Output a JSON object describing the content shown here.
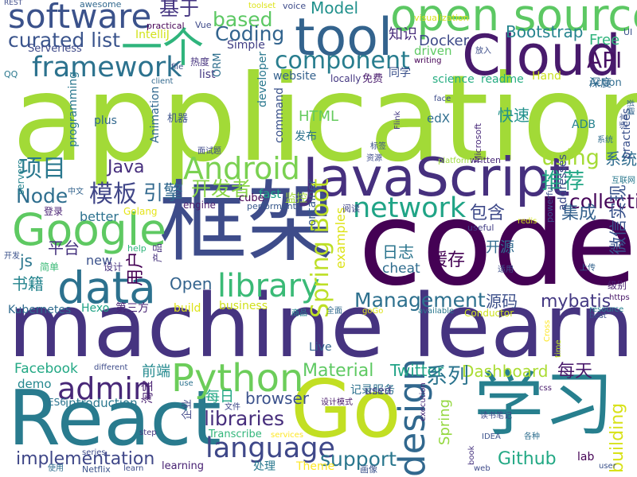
{
  "words": [
    {
      "text": "application",
      "color": "#a2da37"
    },
    {
      "text": "machine learning",
      "color": "#463480"
    },
    {
      "text": "code",
      "color": "#440154"
    },
    {
      "text": "框架",
      "color": "#3e4c8a"
    },
    {
      "text": "React",
      "color": "#297b8e"
    },
    {
      "text": "JavaScript",
      "color": "#46307e"
    },
    {
      "text": "学习",
      "color": "#277f8e"
    },
    {
      "text": "Go",
      "color": "#c2df23"
    },
    {
      "text": "open source",
      "color": "#5cc863"
    },
    {
      "text": "tool",
      "color": "#33638d"
    },
    {
      "text": "Cloud",
      "color": "#481a6c"
    },
    {
      "text": "Google",
      "color": "#5ec962"
    },
    {
      "text": "data",
      "color": "#2c718e"
    },
    {
      "text": "software",
      "color": "#3b528b"
    },
    {
      "text": "一个",
      "color": "#2fb47c"
    },
    {
      "text": "framework",
      "color": "#2c728e"
    },
    {
      "text": "component",
      "color": "#287d8e"
    },
    {
      "text": "Android",
      "color": "#7ad151"
    },
    {
      "text": "Python",
      "color": "#6ccd5a"
    },
    {
      "text": "library",
      "color": "#3aba76"
    },
    {
      "text": "network",
      "color": "#20a486"
    },
    {
      "text": "language",
      "color": "#3f4889"
    },
    {
      "text": "design",
      "color": "#31688e"
    },
    {
      "text": "admin",
      "color": "#482878"
    },
    {
      "text": "Spring Boot",
      "color": "#bddf26"
    },
    {
      "text": "模板",
      "color": "#404688"
    },
    {
      "text": "项目",
      "color": "#2a788e"
    },
    {
      "text": "API",
      "color": "#471164"
    },
    {
      "text": "curated list",
      "color": "#3a548c"
    },
    {
      "text": "based",
      "color": "#5cc863"
    },
    {
      "text": "Coding",
      "color": "#32648e"
    },
    {
      "text": "基于",
      "color": "#453581"
    },
    {
      "text": "Model",
      "color": "#21918c"
    },
    {
      "text": "Bootstrap",
      "color": "#25848e"
    },
    {
      "text": "Free",
      "color": "#2fb47c"
    },
    {
      "text": "知识",
      "color": "#472d7b"
    },
    {
      "text": "Docker",
      "color": "#3e4a89"
    },
    {
      "text": "driven",
      "color": "#5ec962"
    },
    {
      "text": "using",
      "color": "#a5db36"
    },
    {
      "text": "推荐",
      "color": "#21a685"
    },
    {
      "text": "collection",
      "color": "#450559"
    },
    {
      "text": "系统",
      "color": "#2f6c8e"
    },
    {
      "text": "引擎",
      "color": "#31688e"
    },
    {
      "text": "开发者",
      "color": "#89d548"
    },
    {
      "text": "Java",
      "color": "#472f7d"
    },
    {
      "text": "Node",
      "color": "#2e6e8e"
    },
    {
      "text": "包含",
      "color": "#3e4989"
    },
    {
      "text": "集成",
      "color": "#34618d"
    },
    {
      "text": "微信实现",
      "color": "#3a548c"
    },
    {
      "text": "Management",
      "color": "#2d708e"
    },
    {
      "text": "mybatis",
      "color": "#443983"
    },
    {
      "text": "Open",
      "color": "#33638d"
    },
    {
      "text": "Material",
      "color": "#5ec962"
    },
    {
      "text": "Twitter",
      "color": "#20a386"
    },
    {
      "text": "Dashboard",
      "color": "#aadc32"
    },
    {
      "text": "每天",
      "color": "#48186a"
    },
    {
      "text": "implementation",
      "color": "#3f4788"
    },
    {
      "text": "libraries",
      "color": "#472e7c"
    },
    {
      "text": "support",
      "color": "#2a778e"
    },
    {
      "text": "Github",
      "color": "#22a884"
    },
    {
      "text": "building",
      "color": "#d8e219"
    },
    {
      "text": "系列",
      "color": "#2b748e"
    },
    {
      "text": "Spring",
      "color": "#95d840"
    },
    {
      "text": "browser",
      "color": "#3b518b"
    },
    {
      "text": "Facebook",
      "color": "#22a884"
    },
    {
      "text": "cheat",
      "color": "#2f6c8e"
    },
    {
      "text": "日志",
      "color": "#2b758e"
    },
    {
      "text": "缓存",
      "color": "#440154"
    },
    {
      "text": "源码",
      "color": "#3c4f8a"
    },
    {
      "text": "Kubernetes",
      "color": "#2f6b8e"
    },
    {
      "text": "Hexo",
      "color": "#20a386"
    },
    {
      "text": "第三方",
      "color": "#482475"
    },
    {
      "text": "business",
      "color": "#d0e11c"
    },
    {
      "text": "Live",
      "color": "#32648e"
    },
    {
      "text": "前端",
      "color": "#23898e"
    },
    {
      "text": "每日",
      "color": "#22a785"
    },
    {
      "text": "examples",
      "color": "#dde318"
    },
    {
      "text": "Theme",
      "color": "#fde725"
    },
    {
      "text": "learning",
      "color": "#482173"
    },
    {
      "text": "Transcribe",
      "color": "#32b67a"
    },
    {
      "text": "lab",
      "color": "#440154"
    },
    {
      "text": "用户",
      "color": "#440154"
    },
    {
      "text": "书籍",
      "color": "#25848e"
    },
    {
      "text": "平台",
      "color": "#46337f"
    },
    {
      "text": "js",
      "color": "#2a768e"
    },
    {
      "text": "fast",
      "color": "#20a386"
    },
    {
      "text": "HTML",
      "color": "#65cb5e"
    },
    {
      "text": "edX",
      "color": "#2e6e8e"
    },
    {
      "text": "快速",
      "color": "#21918c"
    },
    {
      "text": "开源",
      "color": "#306a8e"
    },
    {
      "text": "监控",
      "color": "#a2da37"
    },
    {
      "text": "记录服务",
      "color": "#2d718e"
    },
    {
      "text": "new",
      "color": "#3b528b"
    },
    {
      "text": "demo",
      "color": "#24878e"
    },
    {
      "text": "introduction",
      "color": "#2a788e"
    },
    {
      "text": "used",
      "color": "#433e85"
    },
    {
      "text": "Serverless",
      "color": "#3e4989"
    },
    {
      "text": "Simple",
      "color": "#423f85"
    },
    {
      "text": "IntelliJ",
      "color": "#d2e21b"
    },
    {
      "text": "website",
      "color": "#34618d"
    },
    {
      "text": "同学",
      "color": "#3b518b"
    },
    {
      "text": "science",
      "color": "#26ad81"
    },
    {
      "text": "readme",
      "color": "#25ac82"
    },
    {
      "text": "Hand",
      "color": "#cae11f"
    },
    {
      "text": "深度",
      "color": "#31688e"
    },
    {
      "text": "practices",
      "color": "#3b518b"
    },
    {
      "text": "ADB",
      "color": "#26828e"
    },
    {
      "text": "addresses",
      "color": "#3e4a89"
    },
    {
      "text": "Microsoft",
      "color": "#482979"
    },
    {
      "text": "command",
      "color": "#3b528b"
    },
    {
      "text": "developer",
      "color": "#2a788e"
    },
    {
      "text": "Animation",
      "color": "#31688e"
    },
    {
      "text": "programming",
      "color": "#2a778e"
    },
    {
      "text": "机器",
      "color": "#3b528b"
    },
    {
      "text": "plus",
      "color": "#31688e"
    },
    {
      "text": "list",
      "color": "#453882"
    },
    {
      "text": "ORM",
      "color": "#2e6f8e"
    },
    {
      "text": "发布",
      "color": "#2c728e"
    },
    {
      "text": "cube",
      "color": "#440154"
    },
    {
      "text": "better",
      "color": "#2c718e"
    },
    {
      "text": "Golang",
      "color": "#e5e419"
    },
    {
      "text": "engine",
      "color": "#48186a"
    },
    {
      "text": "performant",
      "color": "#38588c"
    },
    {
      "text": "container",
      "color": "#38598c"
    },
    {
      "text": "useful",
      "color": "#433e85"
    },
    {
      "text": "阅读",
      "color": "#404688"
    },
    {
      "text": "redis",
      "color": "#d2e21b"
    },
    {
      "text": "powerful",
      "color": "#3e4c8a"
    },
    {
      "text": "登录",
      "color": "#482173"
    },
    {
      "text": "help",
      "color": "#2fb47c"
    },
    {
      "text": "简单",
      "color": "#3aba76"
    },
    {
      "text": "设计",
      "color": "#46307e"
    },
    {
      "text": "产品",
      "color": "#46327e"
    },
    {
      "text": "适用",
      "color": "#3d4e8a"
    },
    {
      "text": "上传",
      "color": "#33638d"
    },
    {
      "text": "级别",
      "color": "#481f70"
    },
    {
      "text": "https",
      "color": "#481769"
    },
    {
      "text": "resource",
      "color": "#26818e"
    },
    {
      "text": "best",
      "color": "#3b528b"
    },
    {
      "text": "Conductor",
      "color": "#cde11d"
    },
    {
      "text": "available",
      "color": "#2a788e"
    },
    {
      "text": "goGo",
      "color": "#dde318"
    },
    {
      "text": "全面",
      "color": "#306a8e"
    },
    {
      "text": "商品",
      "color": "#25858e"
    },
    {
      "text": "build",
      "color": "#dde318"
    },
    {
      "text": "Cross",
      "color": "#fde725"
    },
    {
      "text": "time",
      "color": "#bddf26"
    },
    {
      "text": "different",
      "color": "#3e4c8a"
    },
    {
      "text": "use",
      "color": "#2c738e"
    },
    {
      "text": "淘宝",
      "color": "#482071"
    },
    {
      "text": "文件",
      "color": "#3e4a89"
    },
    {
      "text": "企业",
      "color": "#3f4788"
    },
    {
      "text": "设计模式",
      "color": "#48196b"
    },
    {
      "text": "execution",
      "color": "#482979"
    },
    {
      "text": "ES6",
      "color": "#2c738e"
    },
    {
      "text": "step",
      "color": "#453781"
    },
    {
      "text": "services",
      "color": "#fde725"
    },
    {
      "text": "各种",
      "color": "#2e6e8e"
    },
    {
      "text": "读书笔记",
      "color": "#3e4a89"
    },
    {
      "text": "IDEA",
      "color": "#3b528b"
    },
    {
      "text": "css",
      "color": "#48186a"
    },
    {
      "text": "written",
      "color": "#482878"
    },
    {
      "text": "platform",
      "color": "#9bd93c"
    },
    {
      "text": "资源",
      "color": "#3e4c8a"
    },
    {
      "text": "标签",
      "color": "#3b528b"
    },
    {
      "text": "面试题",
      "color": "#3e4a89"
    },
    {
      "text": "Flink",
      "color": "#443a83"
    },
    {
      "text": "系统",
      "color": "#2f6c8e"
    },
    {
      "text": "互联网",
      "color": "#2a788e"
    },
    {
      "text": "语言",
      "color": "#3b528b"
    },
    {
      "text": "Action",
      "color": "#2f6c8e"
    },
    {
      "text": "免费",
      "color": "#481a6c"
    },
    {
      "text": "locally",
      "color": "#453882"
    },
    {
      "text": "client",
      "color": "#31688e"
    },
    {
      "text": "热度",
      "color": "#46337f"
    },
    {
      "text": "file",
      "color": "#3b528b"
    },
    {
      "text": "practical",
      "color": "#440154"
    },
    {
      "text": "Vue",
      "color": "#3e4a89"
    },
    {
      "text": "toolset",
      "color": "#dde318"
    },
    {
      "text": "awesome",
      "color": "#31688e"
    },
    {
      "text": "voice",
      "color": "#3e4c8a"
    },
    {
      "text": "visualization",
      "color": "#d8e219"
    },
    {
      "text": "writing",
      "color": "#440154"
    },
    {
      "text": "放入",
      "color": "#3d4e8a"
    },
    {
      "text": "UI",
      "color": "#3b528b"
    },
    {
      "text": "REST",
      "color": "#3e4c8a"
    },
    {
      "text": "QQ",
      "color": "#2a788e"
    },
    {
      "text": "servers",
      "color": "#25848e"
    },
    {
      "text": "中文",
      "color": "#33638d"
    },
    {
      "text": "开发",
      "color": "#3b528b"
    },
    {
      "text": "series",
      "color": "#3e4a89"
    },
    {
      "text": "使用",
      "color": "#2f6c8e"
    },
    {
      "text": "Netflix",
      "color": "#3b528b"
    },
    {
      "text": "learn",
      "color": "#3e4c8a"
    },
    {
      "text": "处理",
      "color": "#2a788e"
    },
    {
      "text": "book",
      "color": "#46337f"
    },
    {
      "text": "画像",
      "color": "#3b528b"
    },
    {
      "text": "web",
      "color": "#3e4a89"
    },
    {
      "text": "user",
      "color": "#3b528b"
    },
    {
      "text": "face",
      "color": "#3e4c8a"
    },
    {
      "text": "翻译",
      "color": "#33638d"
    }
  ]
}
